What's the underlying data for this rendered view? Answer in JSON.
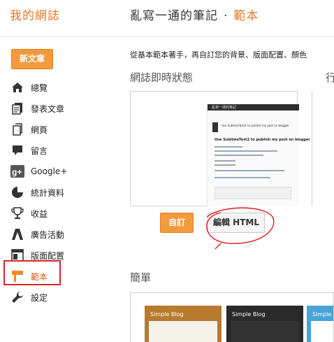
{
  "sidebar": {
    "blog_title": "我的網誌",
    "new_post": "新文章",
    "items": [
      {
        "label": "總覽",
        "icon": "home-icon"
      },
      {
        "label": "發表文章",
        "icon": "posts-icon"
      },
      {
        "label": "網頁",
        "icon": "pages-icon"
      },
      {
        "label": "留言",
        "icon": "comments-icon"
      },
      {
        "label": "Google+",
        "icon": "google-plus-icon"
      },
      {
        "label": "統計資料",
        "icon": "stats-icon"
      },
      {
        "label": "收益",
        "icon": "earnings-icon"
      },
      {
        "label": "廣告活動",
        "icon": "campaigns-icon"
      },
      {
        "label": "版面配置",
        "icon": "layout-icon"
      },
      {
        "label": "範本",
        "icon": "template-icon",
        "active": true
      },
      {
        "label": "設定",
        "icon": "settings-icon"
      }
    ]
  },
  "header": {
    "blog_name": "亂寫一通的筆記",
    "separator": "·",
    "section": "範本"
  },
  "main": {
    "description": "從基本範本著手，再自訂您的背景、版面配置、顏色",
    "live_title": "網誌即時狀態",
    "next_title": "行",
    "customize_button": "自訂",
    "edit_html_button": "編輯 HTML",
    "simple_title": "簡單",
    "preview": {
      "top_bar": "亂寫一通的筆記",
      "post_title": "Use SublimeText2 to publish my post on blogger"
    },
    "thumbnails": [
      "Simple Blog",
      "Simple Blog",
      "Simple Blog"
    ]
  },
  "colors": {
    "accent": "#dd7a2c",
    "button_orange": "#f39a3d",
    "highlight_red": "#d6242a"
  }
}
